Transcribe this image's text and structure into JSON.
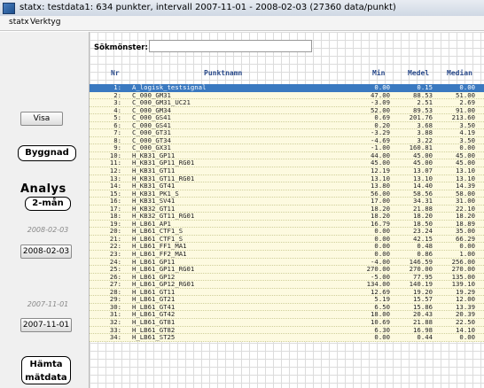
{
  "window": {
    "title": "statx:  testdata1: 634 punkter, intervall 2007-11-01 - 2008-02-03 (27360 data/punkt)"
  },
  "menu": {
    "items": [
      "statx",
      "Verktyg"
    ]
  },
  "sidebar": {
    "visa": "Visa",
    "byggnad": "Byggnad",
    "analys": "Analys",
    "period": "2-mån",
    "date_end_label": "2008-02-03",
    "date_end_button": "2008-02-03",
    "date_start_label": "2007-11-01",
    "date_start_button": "2007-11-01",
    "hamta": "Hämta mätdata"
  },
  "search": {
    "label": "Sökmönster:",
    "value": ""
  },
  "table": {
    "headers": {
      "nr": "Nr",
      "name": "Punktnamn",
      "min": "Min",
      "medel": "Medel",
      "median": "Median"
    },
    "selected_row": 0,
    "rows": [
      [
        "1:",
        "A_logisk_testsignal",
        "0.00",
        "0.15",
        "0.00"
      ],
      [
        "2:",
        "C_000_GM31",
        "47.00",
        "88.53",
        "51.00"
      ],
      [
        "3:",
        "C_000_GM31_UC21",
        "-3.09",
        "2.51",
        "2.69"
      ],
      [
        "4:",
        "C_000_GM34",
        "52.00",
        "89.53",
        "91.00"
      ],
      [
        "5:",
        "C_000_GS41",
        "0.69",
        "201.76",
        "213.60"
      ],
      [
        "6:",
        "C_000_GS41",
        "0.20",
        "3.68",
        "3.50"
      ],
      [
        "7:",
        "C_000_GT31",
        "-3.29",
        "3.88",
        "4.19"
      ],
      [
        "8:",
        "C_000_GT34",
        "-4.69",
        "3.22",
        "3.50"
      ],
      [
        "9:",
        "C_000_GX31",
        "-1.00",
        "160.81",
        "0.00"
      ],
      [
        "10:",
        "H_KB31_GP11",
        "44.00",
        "45.00",
        "45.00"
      ],
      [
        "11:",
        "H_KB31_GP11_RG01",
        "45.00",
        "45.00",
        "45.00"
      ],
      [
        "12:",
        "H_KB31_GT11",
        "12.19",
        "13.07",
        "13.10"
      ],
      [
        "13:",
        "H_KB31_GT11_RG01",
        "13.10",
        "13.10",
        "13.10"
      ],
      [
        "14:",
        "H_KB31_GT41",
        "13.80",
        "14.40",
        "14.39"
      ],
      [
        "15:",
        "H_KB31_PK1_S",
        "56.00",
        "58.56",
        "58.00"
      ],
      [
        "16:",
        "H_KB31_SV41",
        "17.00",
        "34.31",
        "31.00"
      ],
      [
        "17:",
        "H_KB32_GT11",
        "18.20",
        "21.88",
        "22.10"
      ],
      [
        "18:",
        "H_KB32_GT11_RG01",
        "18.20",
        "18.20",
        "18.20"
      ],
      [
        "19:",
        "H_LB61_AP1",
        "16.79",
        "18.50",
        "18.89"
      ],
      [
        "20:",
        "H_LB61_CTF1_S",
        "0.00",
        "23.24",
        "35.00"
      ],
      [
        "21:",
        "H_LB61_CTF1_S",
        "0.00",
        "42.15",
        "66.29"
      ],
      [
        "22:",
        "H_LB61_FF1_MA1",
        "0.00",
        "0.48",
        "0.00"
      ],
      [
        "23:",
        "H_LB61_FF2_MA1",
        "0.00",
        "0.86",
        "1.00"
      ],
      [
        "24:",
        "H_LB61_GP11",
        "-4.00",
        "146.59",
        "256.00"
      ],
      [
        "25:",
        "H_LB61_GP11_RG01",
        "270.00",
        "270.00",
        "270.00"
      ],
      [
        "26:",
        "H_LB61_GP12",
        "-5.00",
        "77.95",
        "135.00"
      ],
      [
        "27:",
        "H_LB61_GP12_RG01",
        "134.00",
        "140.19",
        "139.10"
      ],
      [
        "28:",
        "H_LB61_GT11",
        "12.69",
        "19.20",
        "19.29"
      ],
      [
        "29:",
        "H_LB61_GT21",
        "5.19",
        "15.57",
        "12.00"
      ],
      [
        "30:",
        "H_LB61_GT41",
        "6.50",
        "15.86",
        "13.39"
      ],
      [
        "31:",
        "H_LB61_GT42",
        "18.00",
        "20.43",
        "20.39"
      ],
      [
        "32:",
        "H_LB61_GT81",
        "10.69",
        "21.88",
        "22.50"
      ],
      [
        "33:",
        "H_LB61_GT82",
        "6.30",
        "16.98",
        "14.10"
      ],
      [
        "34:",
        "H_LB61_ST25",
        "0.00",
        "0.44",
        "0.00"
      ]
    ]
  }
}
